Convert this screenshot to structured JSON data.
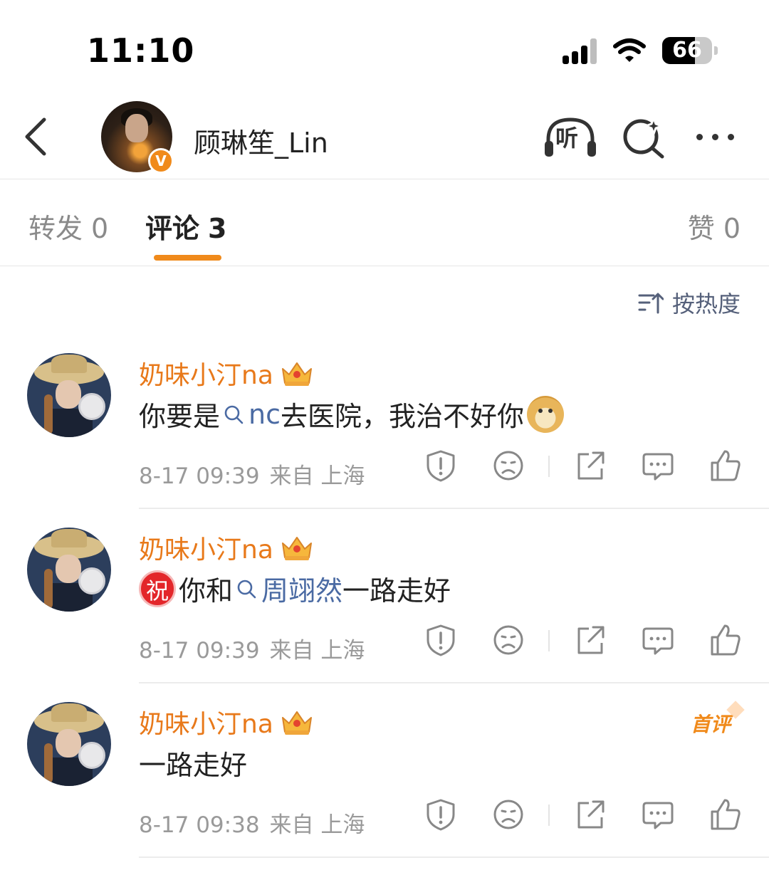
{
  "status_bar": {
    "time": "11:10",
    "battery": "66",
    "battery_level": 0.66
  },
  "header": {
    "back_icon": "chevron-left-icon",
    "verified_badge": "V",
    "title": "顾琳笙_Lin",
    "listen_label": "听",
    "search_icon": "search-sparkle-icon",
    "more_icon": "more-dots-icon"
  },
  "tabs": {
    "repost": {
      "label": "转发",
      "count": "0"
    },
    "comments": {
      "label": "评论",
      "count": "3"
    },
    "likes": {
      "label": "赞",
      "count": "0"
    },
    "accent_color": "#f08a1b"
  },
  "sort": {
    "label": "按热度",
    "icon": "sort-icon"
  },
  "comments": [
    {
      "username": "奶味小汀na",
      "text_before": "你要是",
      "mention": "nc",
      "text_after": "去医院，我治不好你",
      "emoji": "doge-icon",
      "date": "8-17 09:39",
      "source": "来自 上海"
    },
    {
      "username": "奶味小汀na",
      "badge": "祝",
      "text_before": "你和",
      "mention": "周翊然",
      "text_after": "一路走好",
      "date": "8-17 09:39",
      "source": "来自 上海"
    },
    {
      "username": "奶味小汀na",
      "first_badge": "首评",
      "text": "一路走好",
      "date": "8-17 09:38",
      "source": "来自 上海"
    }
  ],
  "colors": {
    "username": "#e8791a",
    "mention": "#4a6aa3",
    "meta": "#9a9a9a"
  }
}
